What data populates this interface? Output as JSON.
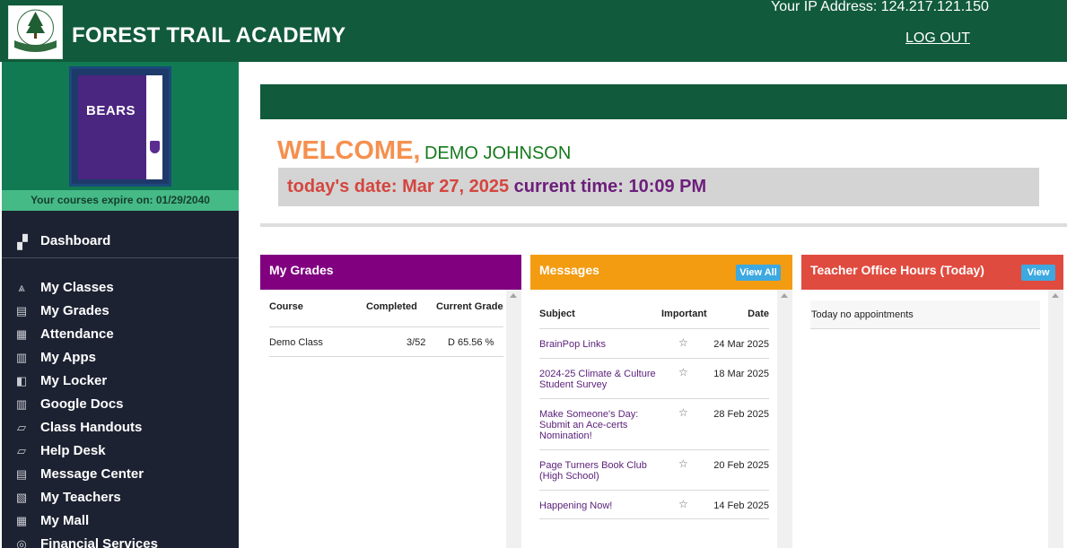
{
  "header": {
    "school_name": "FOREST TRAIL ACADEMY",
    "ip_label": "Your IP Address: 124.217.121.150",
    "logout_label": "LOG OUT"
  },
  "colors": {
    "header_green": "#115a3c",
    "sidebar_dark": "#1d2232",
    "grades_purple": "#800080",
    "messages_orange": "#f39c12",
    "hours_red": "#e04b3f"
  },
  "sidebar": {
    "banner_text": "BEARS",
    "expire_text": "Your courses expire on: 01/29/2040",
    "dashboard": {
      "label": "Dashboard",
      "icon": "dashboard-icon"
    },
    "items": [
      {
        "label": "My Classes",
        "icon": "classes-icon"
      },
      {
        "label": "My Grades",
        "icon": "grades-icon"
      },
      {
        "label": "Attendance",
        "icon": "calendar-icon"
      },
      {
        "label": "My Apps",
        "icon": "apps-icon"
      },
      {
        "label": "My Locker",
        "icon": "locker-icon"
      },
      {
        "label": "Google Docs",
        "icon": "docs-icon"
      },
      {
        "label": "Class Handouts",
        "icon": "handouts-icon"
      },
      {
        "label": "Help Desk",
        "icon": "help-icon"
      },
      {
        "label": "Message Center",
        "icon": "message-icon"
      },
      {
        "label": "My Teachers",
        "icon": "teachers-icon"
      },
      {
        "label": "My Mall",
        "icon": "mall-icon"
      },
      {
        "label": "Financial Services",
        "icon": "finance-icon"
      }
    ]
  },
  "main": {
    "welcome_word": "WELCOME,",
    "user_name": "DEMO JOHNSON",
    "date_text": "today's date: Mar 27, 2025",
    "time_text": "current time: 10:09 PM"
  },
  "grades": {
    "title": "My Grades",
    "headers": {
      "course": "Course",
      "completed": "Completed",
      "grade": "Current Grade"
    },
    "rows": [
      {
        "course": "Demo Class",
        "completed": "3/52",
        "grade": "D 65.56 %"
      }
    ]
  },
  "messages": {
    "title": "Messages",
    "view_all_label": "View All",
    "headers": {
      "subject": "Subject",
      "important": "Important",
      "date": "Date"
    },
    "rows": [
      {
        "subject": "BrainPop Links",
        "date": "24 Mar 2025"
      },
      {
        "subject": "2024-25 Climate & Culture Student Survey",
        "date": "18 Mar 2025"
      },
      {
        "subject": "Make Someone's Day: Submit an Ace-certs Nomination!",
        "date": "28 Feb 2025"
      },
      {
        "subject": "Page Turners Book Club (High School)",
        "date": "20 Feb 2025"
      },
      {
        "subject": "Happening Now!",
        "date": "14 Feb 2025"
      }
    ],
    "star_glyph": "☆"
  },
  "office_hours": {
    "title": "Teacher Office Hours (Today)",
    "view_label": "View",
    "empty_text": "Today no appointments"
  }
}
